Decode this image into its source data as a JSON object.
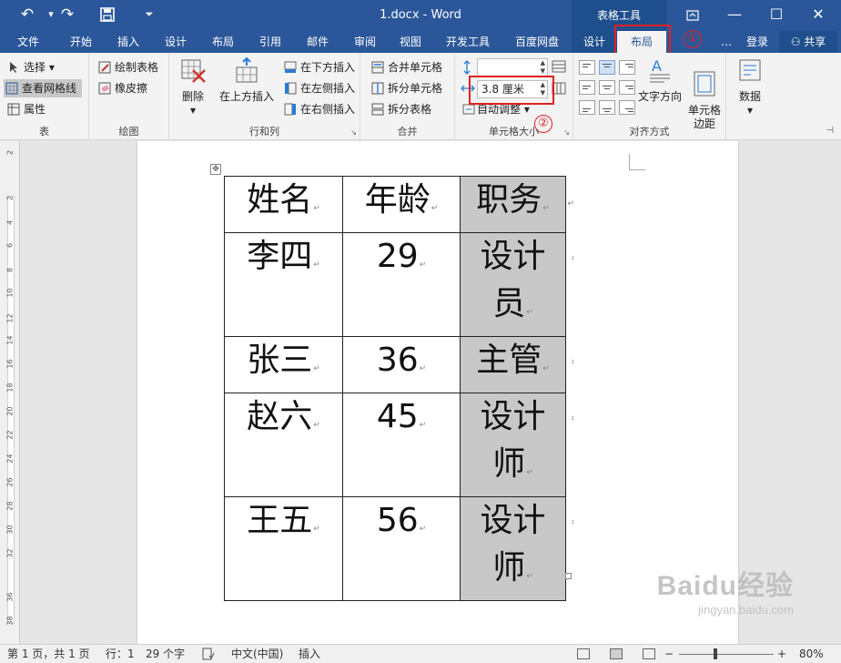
{
  "titlebar": {
    "doc_title": "1.docx - Word",
    "context_group": "表格工具",
    "undo_icon": "undo-icon",
    "redo_icon": "redo-icon",
    "save_icon": "save-icon",
    "customize_icon": "chevron-down-icon"
  },
  "tabs": [
    "文件",
    "开始",
    "插入",
    "设计",
    "布局",
    "引用",
    "邮件",
    "审阅",
    "视图",
    "开发工具",
    "百度网盘",
    "设计",
    "布局",
    "…",
    "登录",
    "共享"
  ],
  "annotations": {
    "one": "①",
    "two": "②"
  },
  "ribbon": {
    "table": {
      "select": "选择",
      "gridlines": "查看网格线",
      "properties": "属性",
      "label": "表"
    },
    "draw": {
      "draw_table": "绘制表格",
      "eraser": "橡皮擦",
      "label": "绘图"
    },
    "rows_cols": {
      "delete": "删除",
      "insert_above": "在上方插入",
      "insert_below": "在下方插入",
      "insert_left": "在左侧插入",
      "insert_right": "在右侧插入",
      "label": "行和列"
    },
    "merge": {
      "merge_cells": "合并单元格",
      "split_cells": "拆分单元格",
      "split_table": "拆分表格",
      "label": "合并"
    },
    "cell_size": {
      "height_value": "",
      "width_value": "3.8 厘米",
      "autofit": "自动调整",
      "label": "单元格大小"
    },
    "alignment": {
      "text_direction": "文字方向",
      "cell_margins": "单元格\n边距",
      "label": "对齐方式"
    },
    "data": {
      "label": "数据"
    }
  },
  "table": {
    "rows": [
      [
        "姓名",
        "年龄",
        "职务"
      ],
      [
        "李四",
        "29",
        "设计员"
      ],
      [
        "张三",
        "36",
        "主管"
      ],
      [
        "赵六",
        "45",
        "设计师"
      ],
      [
        "王五",
        "56",
        "设计师"
      ]
    ]
  },
  "ruler": [
    "2",
    "2",
    "4",
    "6",
    "8",
    "10",
    "12",
    "14",
    "16",
    "18",
    "20",
    "22",
    "24",
    "26",
    "28",
    "30",
    "32",
    "36",
    "38"
  ],
  "status": {
    "page": "第 1 页，共 1 页",
    "line": "行：1",
    "words": "29 个字",
    "language": "中文(中国)",
    "mode": "插入",
    "zoom": "80%"
  },
  "watermark": {
    "brand": "Baidu经验",
    "url": "jingyan.baidu.com"
  }
}
